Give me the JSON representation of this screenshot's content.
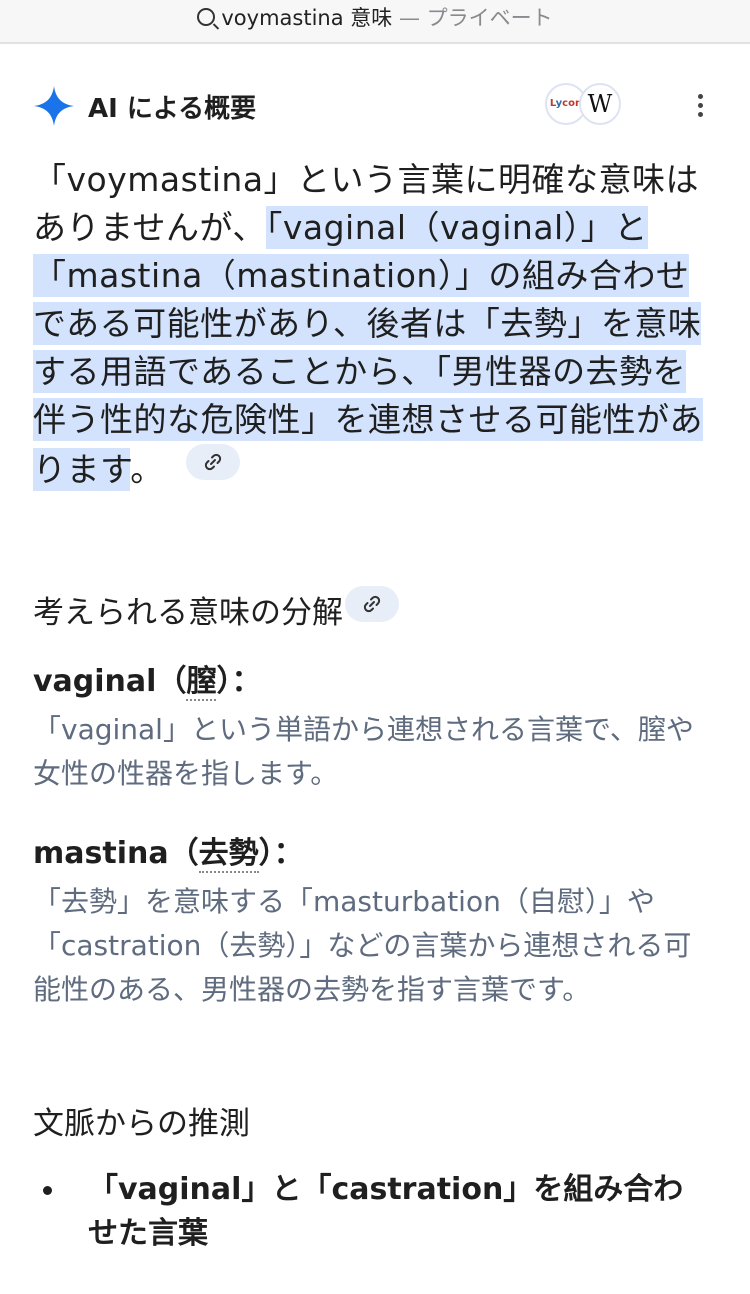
{
  "browser": {
    "query": "voymastina 意味",
    "private_label": "— プライベート"
  },
  "overview": {
    "title": "AI による概要",
    "sources": [
      "Lycon",
      "Wikipedia"
    ],
    "summary_plain": "「voymastina」という言葉に明確な意味はありませんが、",
    "summary_highlight": "「vaginal（vaginal）」と「mastina（mastination）」の組み合わせである可能性があり、後者は「去勢」を意味する用語であることから、「男性器の去勢を伴う性的な危険性」を連想させる可能性があります",
    "summary_end": "。"
  },
  "breakdown": {
    "heading": "考えられる意味の分解",
    "items": [
      {
        "term": "vaginal",
        "gloss_open": "（",
        "gloss": "膣",
        "gloss_close": "）：",
        "desc": "「vaginal」という単語から連想される言葉で、膣や女性の性器を指します。"
      },
      {
        "term": "mastina",
        "gloss_open": "（",
        "gloss": "去勢",
        "gloss_close": "）：",
        "desc": "「去勢」を意味する「masturbation（自慰）」や「castration（去勢）」などの言葉から連想される可能性のある、男性器の去勢を指す言葉です。"
      }
    ]
  },
  "context": {
    "heading": "文脈からの推測",
    "bullets": [
      "「vaginal」と「castration」を組み合わせた言葉"
    ]
  },
  "colors": {
    "highlight": "#d3e3fd",
    "spark": "#1a73e8",
    "muted_text": "#5f6b7e"
  },
  "icons": [
    "sparkle-icon",
    "lycon-source-icon",
    "wikipedia-source-icon",
    "more-vert-icon",
    "link-icon",
    "search-icon"
  ]
}
